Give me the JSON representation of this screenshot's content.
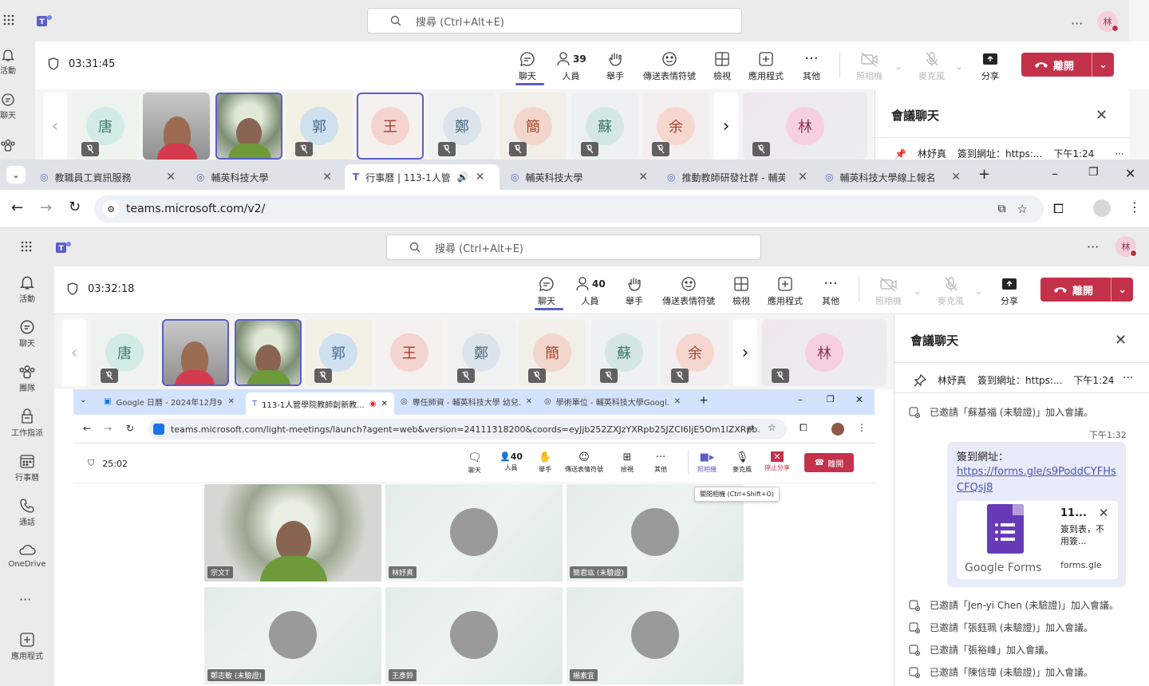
{
  "background_window": {
    "search_placeholder": "搜尋 (Ctrl+Alt+E)",
    "timer": "03:31:45",
    "people_count": "39",
    "avatar_initial": "林",
    "rail": [
      "活動",
      "聊天"
    ],
    "participants": [
      "唐",
      "郭",
      "王",
      "鄭",
      "簡",
      "蘇",
      "余",
      "林"
    ],
    "chat_title": "會議聊天",
    "pinned_author": "林妤真",
    "pinned_text": "簽到網址：https:...",
    "pinned_time": "下午1:24"
  },
  "browser": {
    "tabs": [
      {
        "title": "教職員工資訊服務"
      },
      {
        "title": "輔英科技大學"
      },
      {
        "title": "行事曆 | 113-1人管"
      },
      {
        "title": "輔英科技大學"
      },
      {
        "title": "推動教師研發社群 - 輔英"
      },
      {
        "title": "輔英科技大學線上報名"
      }
    ],
    "url": "teams.microsoft.com/v2/"
  },
  "teams": {
    "search_placeholder": "搜尋 (Ctrl+Alt+E)",
    "avatar_initial": "林",
    "rail": [
      {
        "label": "活動",
        "icon": "bell-icon"
      },
      {
        "label": "聊天",
        "icon": "chat-icon"
      },
      {
        "label": "團隊",
        "icon": "teams-icon"
      },
      {
        "label": "工作指派",
        "icon": "assignments-icon"
      },
      {
        "label": "行事曆",
        "icon": "calendar-icon"
      },
      {
        "label": "通話",
        "icon": "phone-icon"
      },
      {
        "label": "OneDrive",
        "icon": "cloud-icon"
      },
      {
        "label": "應用程式",
        "icon": "apps-icon"
      }
    ],
    "timer": "03:32:18",
    "toolbar": {
      "chat": "聊天",
      "people": "人員",
      "people_count": "40",
      "raise": "舉手",
      "react": "傳送表情符號",
      "view": "檢視",
      "apps": "應用程式",
      "more": "其他",
      "camera": "照相機",
      "mic": "麥克風",
      "share": "分享",
      "leave": "離開"
    },
    "participants": [
      "唐",
      "郭",
      "王",
      "鄭",
      "簡",
      "蘇",
      "余",
      "林"
    ]
  },
  "chat": {
    "title": "會議聊天",
    "pinned_author": "林妤真",
    "pinned_text": "簽到網址：https:...",
    "pinned_time": "下午1:24",
    "system_top": "已邀請「蘇基福 (未驗證)」加入會議。",
    "msg_time": "下午1:32",
    "msg_text": "簽到網址：",
    "msg_link": "https://forms.gle/s9PoddCYFHsCFQsj8",
    "card_title": "11...",
    "card_desc": "簽到表，不用簽...",
    "card_domain": "forms.gle",
    "card_brand": "Google Forms",
    "system_bottom": [
      "已邀請「Jen-yi Chen (未驗證)」加入會議。",
      "已邀請「張鈺珮 (未驗證)」加入會議。",
      "已邀請「張裕峰」加入會議。",
      "已邀請「陳信瑋 (未驗證)」加入會議。"
    ]
  },
  "shared": {
    "tabs": [
      "Google 日曆 - 2024年12月9日",
      "113-1人管學院教師創新教...",
      "專任師資 - 輔英科技大學 幼兒...",
      "學術單位 - 輔英科技大學Googl..."
    ],
    "url": "teams.microsoft.com/light-meetings/launch?agent=web&version=24111318200&coords=eyJjb252ZXJzYXRpb25JZCI6IjE5Om1lZXRpb...",
    "timer": "25:02",
    "people_count": "40",
    "tools": [
      "聊天",
      "人員",
      "舉手",
      "傳送表情符號",
      "檢視",
      "其他",
      "照相機",
      "麥克風",
      "停止分享"
    ],
    "leave": "離開",
    "tooltip": "關閉相機 (Ctrl+Shift+O)",
    "tiles": [
      "宗文T",
      "林妤真",
      "簡君竑 (未驗證)",
      "鄭志敏 (未驗證)",
      "王彥鈴",
      "楊素宜"
    ]
  }
}
